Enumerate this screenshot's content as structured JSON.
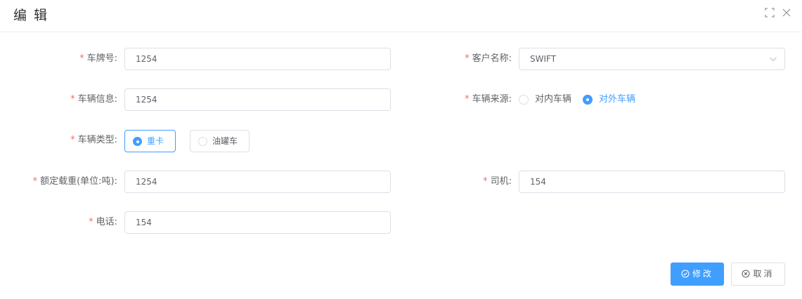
{
  "dialog": {
    "title": "编 辑"
  },
  "form": {
    "plate": {
      "label": "车牌号:",
      "required": "*",
      "value": "1254"
    },
    "customer": {
      "label": "客户名称:",
      "required": "*",
      "value": "SWIFT"
    },
    "vehicle_info": {
      "label": "车辆信息:",
      "required": "*",
      "value": "1254"
    },
    "vehicle_source": {
      "label": "车辆来源:",
      "required": "*",
      "options": [
        "对内车辆",
        "对外车辆"
      ],
      "selected": "对外车辆"
    },
    "vehicle_type": {
      "label": "车辆类型:",
      "required": "*",
      "options": [
        "重卡",
        "油罐车"
      ],
      "selected": "重卡"
    },
    "load": {
      "label": "额定载重(单位:吨):",
      "required": "*",
      "value": "1254"
    },
    "driver": {
      "label": "司机:",
      "required": "*",
      "value": "154"
    },
    "phone": {
      "label": "电话:",
      "required": "*",
      "value": "154"
    }
  },
  "footer": {
    "submit_label": "修改",
    "cancel_label": "取消"
  },
  "colors": {
    "primary": "#409eff",
    "required": "#f56c6c",
    "border": "#dcdfe6",
    "text": "#606266"
  },
  "icons": {
    "maximize": "fullscreen-icon",
    "close": "close-icon",
    "select_arrow": "chevron-down-icon",
    "submit": "check-circle-icon",
    "cancel": "close-circle-icon"
  }
}
